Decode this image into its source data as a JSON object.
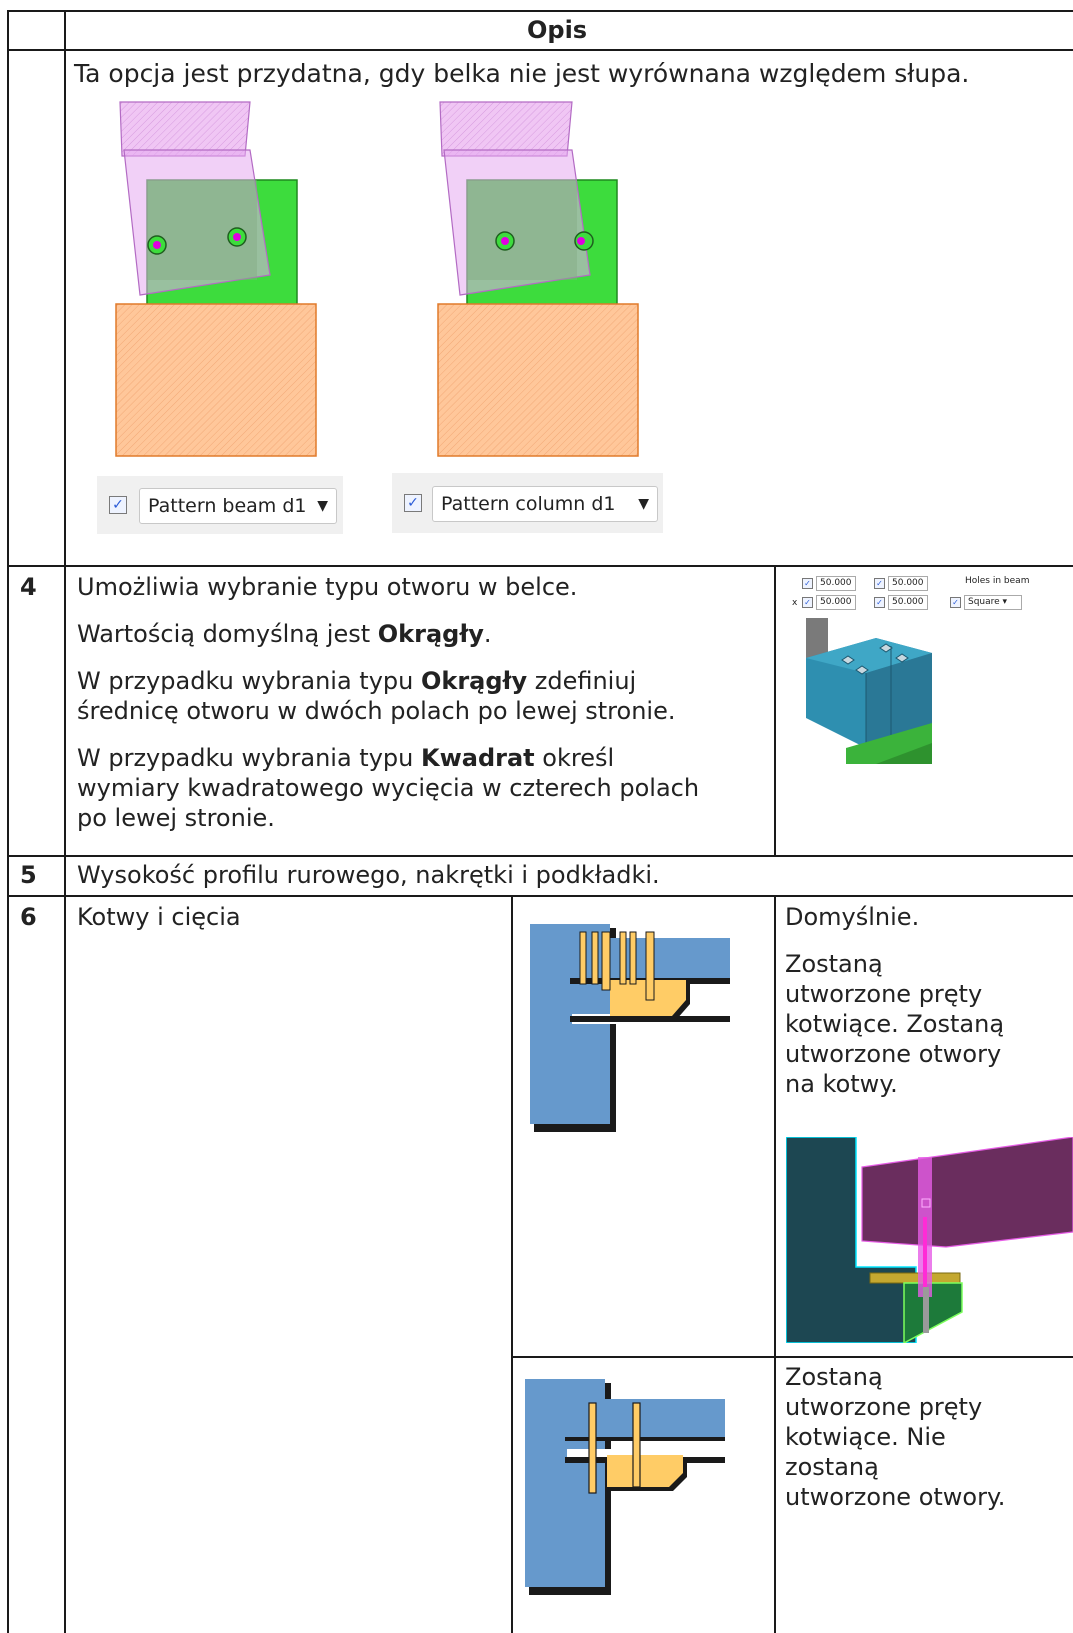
{
  "table": {
    "header": "Opis",
    "row_intro": {
      "text": "Ta opcja jest przydatna, gdy belka nie jest wyrównana względem słupa.",
      "dropdown_left": "Pattern beam d1",
      "dropdown_right": "Pattern column d1"
    },
    "row4": {
      "number": "4",
      "p1": "Umożliwia wybranie typu otworu w belce.",
      "p2_before": "Wartością domyślną jest ",
      "p2_bold": "Okrągły",
      "p2_after": ".",
      "p3_before": "W przypadku wybrania typu ",
      "p3_bold": "Okrągły",
      "p3_after_line1": " zdefiniuj",
      "p3_line2": "średnicę otworu w dwóch polach po lewej stronie.",
      "p4_before": "W przypadku wybrania typu ",
      "p4_bold": "Kwadrat",
      "p4_after_line1": " określ",
      "p4_line2": "wymiary kwadratowego wycięcia w czterech polach",
      "p4_line3": "po lewej stronie.",
      "mini_ui": {
        "v1": "50.000",
        "v2": "50.000",
        "v3": "50.000",
        "v4": "50.000",
        "x_label": "x",
        "holes_label": "Holes in beam",
        "select_value": "Square"
      }
    },
    "row5": {
      "number": "5",
      "text": "Wysokość profilu rurowego, nakrętki i podkładki."
    },
    "row6": {
      "number": "6",
      "label": "Kotwy i cięcia",
      "opt1_l1": "Domyślnie.",
      "opt1_l2": "Zostaną",
      "opt1_l3": "utworzone pręty",
      "opt1_l4": "kotwiące. Zostaną",
      "opt1_l5": "utworzone otwory",
      "opt1_l6": "na kotwy.",
      "opt2_l1": "Zostaną",
      "opt2_l2": "utworzone pręty",
      "opt2_l3": "kotwiące. Nie",
      "opt2_l4": "zostaną",
      "opt2_l5": "utworzone otwory."
    }
  },
  "colors": {
    "beam_pink": "#f0c6f4",
    "plate_green": "#3ddc3d",
    "column_orange": "#ffc79a",
    "steel_blue": "#6699cc",
    "plate_yellow": "#ffcc66"
  }
}
